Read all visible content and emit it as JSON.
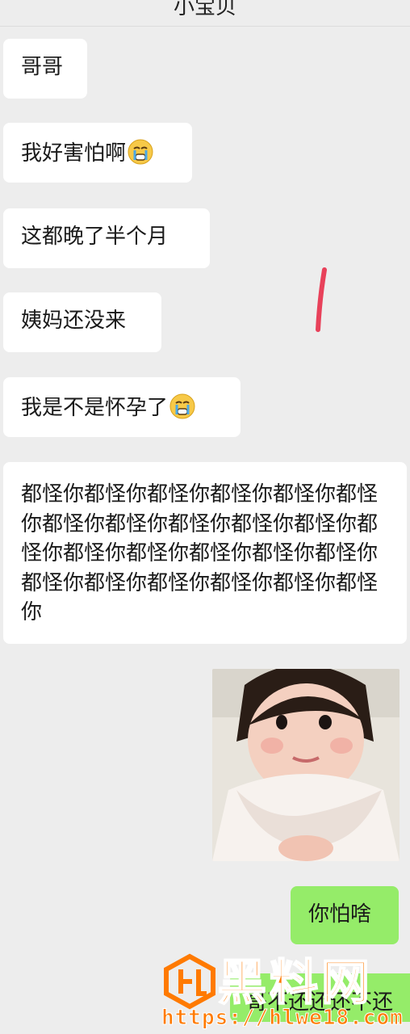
{
  "header": {
    "title": "小宝贝"
  },
  "messages": {
    "m1": "哥哥",
    "m2": "我好害怕啊",
    "m3": "这都晚了半个月",
    "m4": "姨妈还没来",
    "m5": "我是不是怀孕了",
    "m6": "都怪你都怪你都怪你都怪你都怪你都怪你都怪你都怪你都怪你都怪你都怪你都怪你都怪你都怪你都怪你都怪你都怪你都怪你都怪你都怪你都怪你都怪你都怪你",
    "m7": "你怕啥",
    "m8": "哥不还还还不还"
  },
  "icons": {
    "cry_emoji": "crying-face-icon",
    "photo": "baby-photo"
  },
  "watermark": {
    "brand": "黑料网",
    "url": "https://hlwe18.com"
  },
  "colors": {
    "background": "#ededed",
    "incoming_bubble": "#ffffff",
    "outgoing_bubble": "#95ec69",
    "watermark": "#ff7a00",
    "mark": "#e8415a"
  }
}
